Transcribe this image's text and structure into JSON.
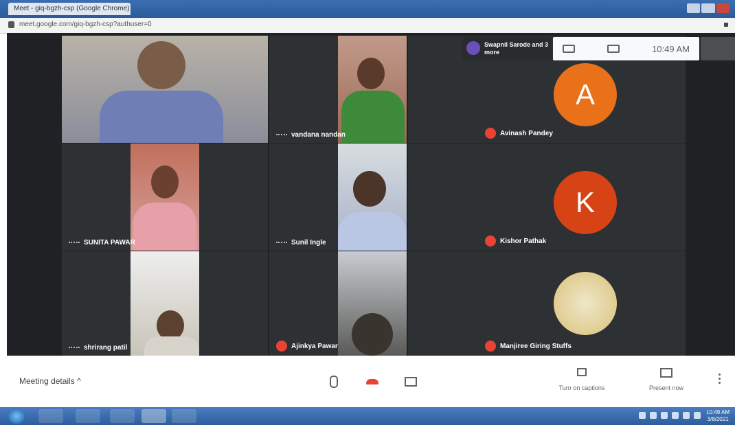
{
  "browser": {
    "tab_title": "Meet - giq-bgzh-csp (Google Chrome)",
    "url": "meet.google.com/giq-bgzh-csp?authuser=0"
  },
  "meet": {
    "presenting_text": "Swapnil Sarode and 3 more",
    "clock": "10:49 AM",
    "tiles": [
      {
        "name": ""
      },
      {
        "name": "vandana nandan"
      },
      {
        "name": "Avinash Pandey",
        "avatar_letter": "A",
        "avatar_color": "#e8711a"
      },
      {
        "name": "SUNITA PAWAR"
      },
      {
        "name": "Sunil Ingle"
      },
      {
        "name": "Kishor Pathak",
        "avatar_letter": "K",
        "avatar_color": "#d84315"
      },
      {
        "name": "shrirang patil"
      },
      {
        "name": "Ajinkya Pawar"
      },
      {
        "name": "Manjiree Giring Stuffs"
      }
    ]
  },
  "controls": {
    "meeting_details": "Meeting details",
    "captions_label": "Turn on captions",
    "present_label": "Present now"
  },
  "taskbar": {
    "time": "10:49 AM",
    "date": "3/8/2021"
  }
}
